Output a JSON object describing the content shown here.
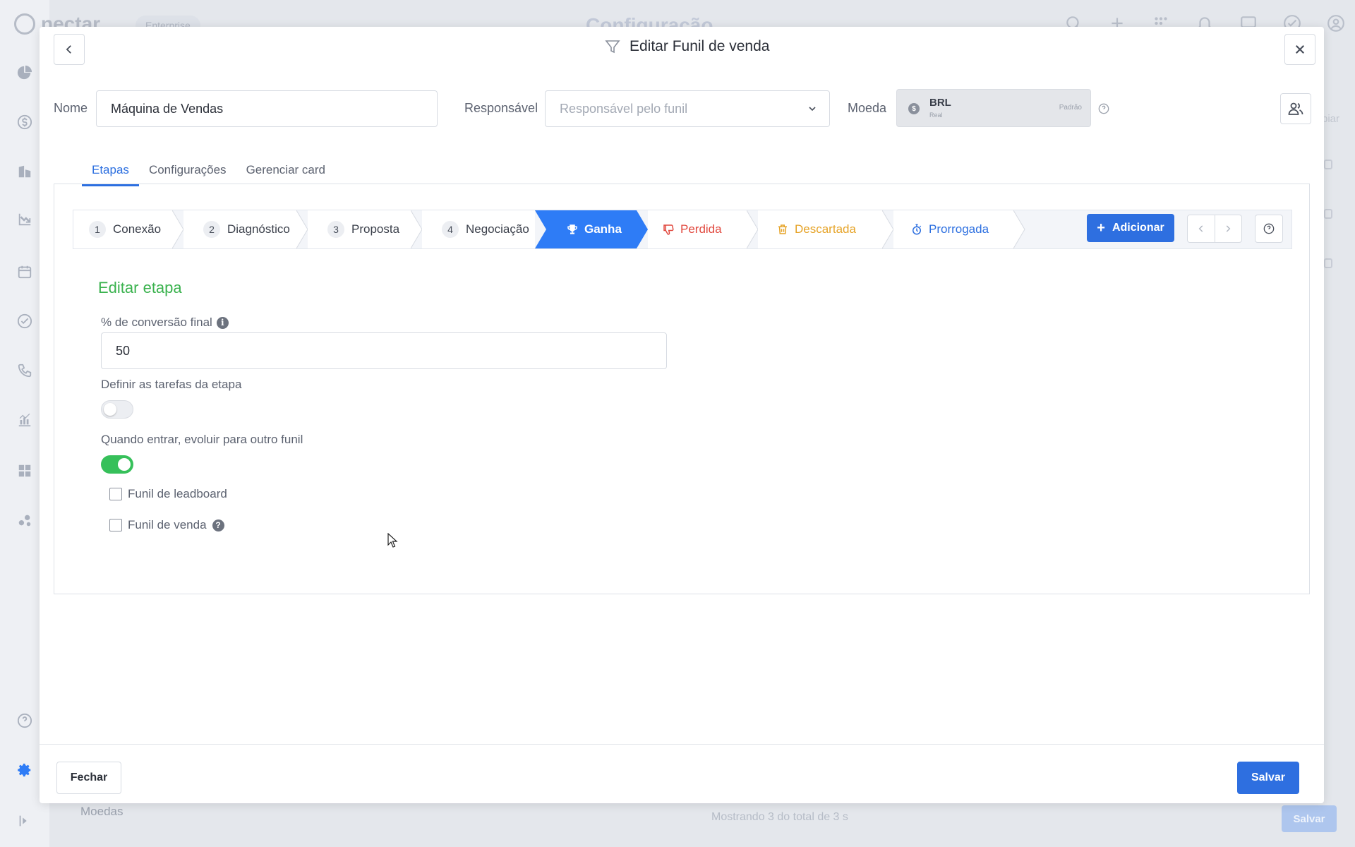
{
  "background": {
    "logo": "nectar",
    "plan_badge": "Enterprise",
    "page_title": "Configuração",
    "right_text": "piar",
    "footer_label": "Moedas",
    "footer_count": "Mostrando 3 do total de 3 s",
    "footer_save": "Salvar"
  },
  "modal": {
    "title": "Editar Funil de venda",
    "name_label": "Nome",
    "name_value": "Máquina de Vendas",
    "owner_label": "Responsável",
    "owner_placeholder": "Responsável pelo funil",
    "currency_label": "Moeda",
    "currency": {
      "code": "BRL",
      "name": "Real",
      "default": "Padrão"
    },
    "tabs": [
      {
        "label": "Etapas",
        "active": true
      },
      {
        "label": "Configurações",
        "active": false
      },
      {
        "label": "Gerenciar card",
        "active": false
      }
    ],
    "stages": [
      {
        "number": "1",
        "label": "Conexão"
      },
      {
        "number": "2",
        "label": "Diagnóstico"
      },
      {
        "number": "3",
        "label": "Proposta"
      },
      {
        "number": "4",
        "label": "Negociação"
      },
      {
        "icon": "trophy-icon",
        "label": "Ganha",
        "active": true,
        "color": "#2e7cf6"
      },
      {
        "icon": "thumbs-down-icon",
        "label": "Perdida",
        "color": "#e1483e"
      },
      {
        "icon": "trash-icon",
        "label": "Descartada",
        "color": "#e6a327"
      },
      {
        "icon": "stopwatch-icon",
        "label": "Prorrogada",
        "color": "#2c6fe0"
      }
    ],
    "add_button": "Adicionar",
    "edit_stage": {
      "title": "Editar etapa",
      "conversion_label": "% de conversão final",
      "conversion_value": "50",
      "tasks_label": "Definir as tarefas da etapa",
      "tasks_enabled": false,
      "evolve_label": "Quando entrar, evoluir para outro funil",
      "evolve_enabled": true,
      "options": [
        {
          "label": "Funil de leadboard",
          "checked": false
        },
        {
          "label": "Funil de venda",
          "checked": false
        }
      ]
    },
    "close_button": "Fechar",
    "save_button": "Salvar"
  },
  "colors": {
    "primary": "#2e6fe0",
    "success": "#36c05a",
    "danger": "#e1483e",
    "warning": "#e6a327"
  }
}
